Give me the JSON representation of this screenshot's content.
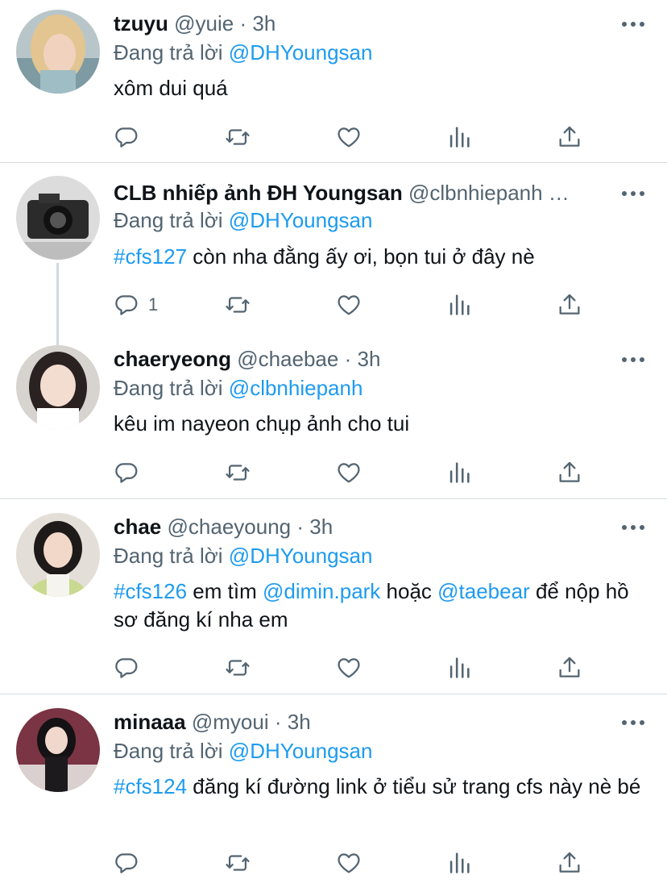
{
  "tweets": [
    {
      "name": "tzuyu",
      "handle": "@yuie",
      "dot": "·",
      "time": "3h",
      "replying_prefix": "Đang trả lời",
      "replying_to": "@DHYoungsan",
      "text": "xôm dui quá",
      "reply_count": ""
    },
    {
      "name": "CLB nhiếp ảnh ĐH Youngsan",
      "handle": "@clbnhiepanh …",
      "replying_prefix": "Đang trả lời",
      "replying_to": "@DHYoungsan",
      "hashtag": "#cfs127",
      "text": " còn nha đằng ấy ơi, bọn tui ở đây nè",
      "reply_count": "1"
    },
    {
      "name": "chaeryeong",
      "handle": "@chaebae",
      "dot": "·",
      "time": "3h",
      "replying_prefix": "Đang trả lời",
      "replying_to": "@clbnhiepanh",
      "text": "kêu im nayeon chụp ảnh cho tui",
      "reply_count": ""
    },
    {
      "name": "chae",
      "handle": "@chaeyoung",
      "dot": "·",
      "time": "3h",
      "replying_prefix": "Đang trả lời",
      "replying_to": "@DHYoungsan",
      "hashtag": "#cfs126",
      "text_a": " em tìm ",
      "mention_a": "@dimin.park",
      "text_b": " hoặc ",
      "mention_b": "@taebear",
      "text_c": " để nộp hồ sơ đăng kí nha em",
      "reply_count": ""
    },
    {
      "name": "minaaa",
      "handle": "@myoui",
      "dot": "·",
      "time": "3h",
      "replying_prefix": "Đang trả lời",
      "replying_to": "@DHYoungsan",
      "hashtag": "#cfs124",
      "text": " đăng kí đường link ở tiểu sử trang cfs này nè bé",
      "reply_count": ""
    }
  ],
  "icons": [
    "reply-icon",
    "retweet-icon",
    "like-icon",
    "analytics-icon",
    "share-icon",
    "more-icon"
  ],
  "colors": {
    "link": "#1d9bf0",
    "muted": "#536471",
    "text": "#0f1419",
    "divider": "#d6dbdf"
  }
}
